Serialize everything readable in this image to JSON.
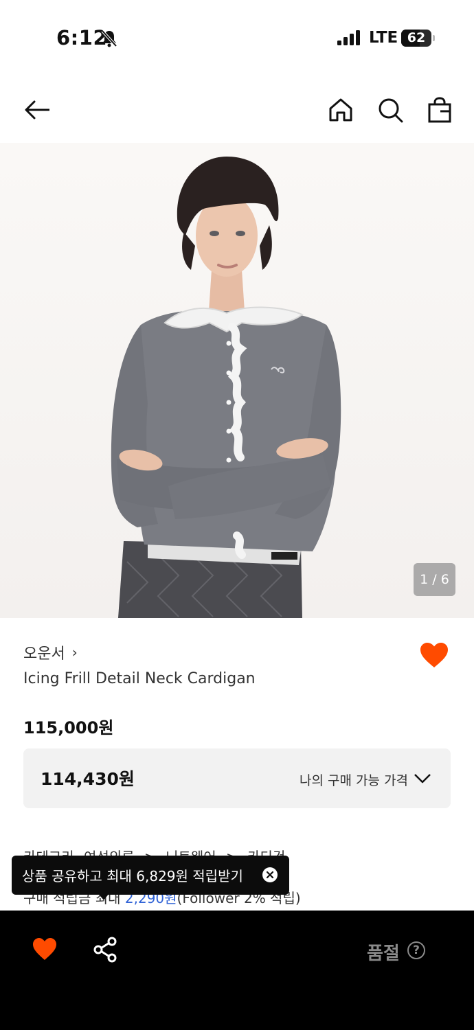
{
  "status_bar": {
    "time": "6:12",
    "network": "LTE",
    "battery": "62",
    "battery_level": 0.62,
    "icons": [
      "bell-slash-icon",
      "signal-icon"
    ]
  },
  "header": {
    "icons": [
      "back-arrow-icon",
      "home-icon",
      "search-icon",
      "shopping-bag-icon"
    ]
  },
  "gallery": {
    "counter": "1 / 6"
  },
  "product": {
    "brand": "오운서",
    "brand_chevron": "›",
    "name": "Icing Frill Detail Neck Cardigan",
    "price": "115,000원",
    "my_price": "114,430원",
    "my_price_label": "나의 구매 가능 가격",
    "wishlisted": true,
    "accent_color": "#ff4b00"
  },
  "details": {
    "category_label": "카테고리",
    "category_path": [
      "여성의류",
      "니트웨어",
      "카디건"
    ],
    "category_separator": ">",
    "points_label": "구매 적립금",
    "points_prefix": "최대",
    "points_value": "2,290원",
    "points_suffix": "(Follower 2% 적립)"
  },
  "tooltip": {
    "text": "상품 공유하고 최대 6,829원 적립받기"
  },
  "bottom_bar": {
    "status_label": "품절",
    "help": "?"
  }
}
